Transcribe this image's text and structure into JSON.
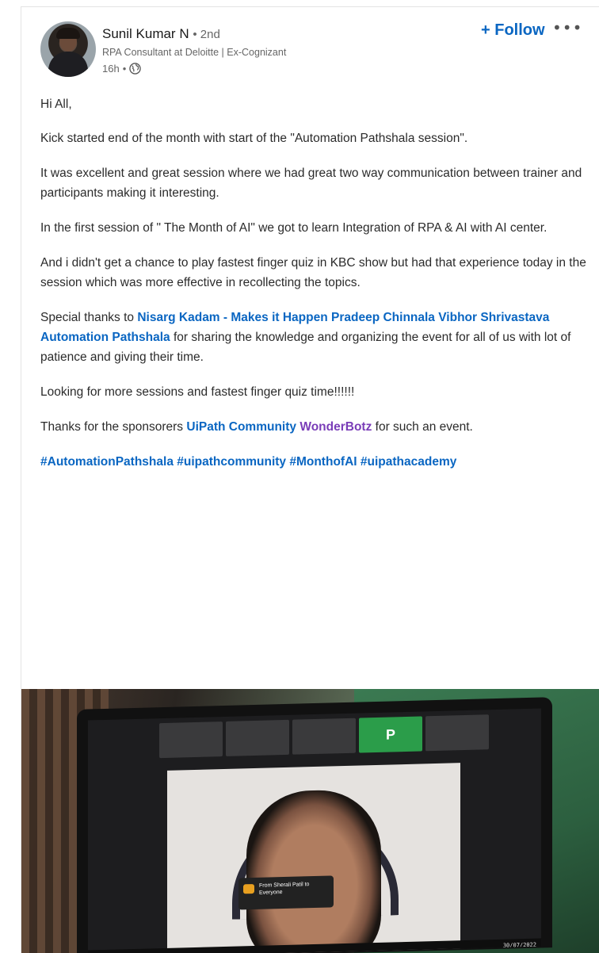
{
  "author": {
    "name": "Sunil Kumar N",
    "degree": "2nd",
    "headline": "RPA Consultant at Deloitte | Ex-Cognizant",
    "time": "16h"
  },
  "actions": {
    "follow_label": "+ Follow",
    "more_label": "•••"
  },
  "post": {
    "greeting": "Hi All,",
    "p1": "Kick started end of the month with start of the \"Automation Pathshala session\".",
    "p2": "It was excellent and great session where we had great two way communication between trainer and participants making it interesting.",
    "p3": "In the first session of \" The Month of AI\" we got to learn Integration of RPA & AI with AI center.",
    "p4": "And i didn't get a chance to play fastest finger quiz in KBC show but had that experience today in the session which was more effective in recollecting the topics.",
    "thanks_prefix": "Special thanks to",
    "mention1": "Nisarg Kadam - Makes it Happen",
    "mention2": "Pradeep Chinnala",
    "mention3": "Vibhor Shrivastava",
    "mention4": "Automation Pathshala",
    "thanks_suffix": "for sharing the knowledge and organizing the event for all of us with lot of patience and giving their time.",
    "p6": "Looking for more sessions and fastest finger quiz time!!!!!!",
    "sponsor_prefix": "Thanks for the sponsorers",
    "sponsor1": "UiPath Community",
    "sponsor2": "WonderBotz",
    "sponsor_suffix": "for such an event.",
    "hashtags": "#AutomationPathshala #uipathcommunity #MonthofAI #uipathacademy"
  },
  "photo": {
    "tile_letter": "P",
    "chat_text": "From Sherali Patil to Everyone",
    "timestamp": "30/07/2022"
  },
  "colors": {
    "link": "#0a66c2",
    "mention_purple": "#7a3db8"
  }
}
